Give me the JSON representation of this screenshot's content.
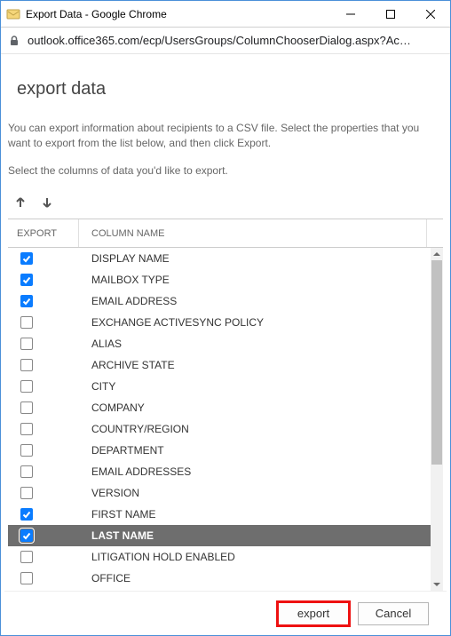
{
  "window": {
    "title": "Export Data - Google Chrome"
  },
  "address": {
    "url": "outlook.office365.com/ecp/UsersGroups/ColumnChooserDialog.aspx?Ac…"
  },
  "page": {
    "heading": "export data",
    "description1": "You can export information about recipients to a CSV file. Select the properties that you want to export from the list below, and then click Export.",
    "description2": "Select the columns of data you'd like to export."
  },
  "table": {
    "headers": {
      "export": "EXPORT",
      "name": "COLUMN NAME"
    },
    "rows": [
      {
        "label": "DISPLAY NAME",
        "checked": true,
        "selected": false
      },
      {
        "label": "MAILBOX TYPE",
        "checked": true,
        "selected": false
      },
      {
        "label": "EMAIL ADDRESS",
        "checked": true,
        "selected": false
      },
      {
        "label": "EXCHANGE ACTIVESYNC POLICY",
        "checked": false,
        "selected": false
      },
      {
        "label": "ALIAS",
        "checked": false,
        "selected": false
      },
      {
        "label": "ARCHIVE STATE",
        "checked": false,
        "selected": false
      },
      {
        "label": "CITY",
        "checked": false,
        "selected": false
      },
      {
        "label": "COMPANY",
        "checked": false,
        "selected": false
      },
      {
        "label": "COUNTRY/REGION",
        "checked": false,
        "selected": false
      },
      {
        "label": "DEPARTMENT",
        "checked": false,
        "selected": false
      },
      {
        "label": "EMAIL ADDRESSES",
        "checked": false,
        "selected": false
      },
      {
        "label": "VERSION",
        "checked": false,
        "selected": false
      },
      {
        "label": "FIRST NAME",
        "checked": true,
        "selected": false
      },
      {
        "label": "LAST NAME",
        "checked": true,
        "selected": true
      },
      {
        "label": "LITIGATION HOLD ENABLED",
        "checked": false,
        "selected": false
      },
      {
        "label": "OFFICE",
        "checked": false,
        "selected": false
      }
    ]
  },
  "buttons": {
    "export": "export",
    "cancel": "Cancel"
  },
  "scroll": {
    "thumbTop": 14,
    "thumbHeight": 230
  }
}
